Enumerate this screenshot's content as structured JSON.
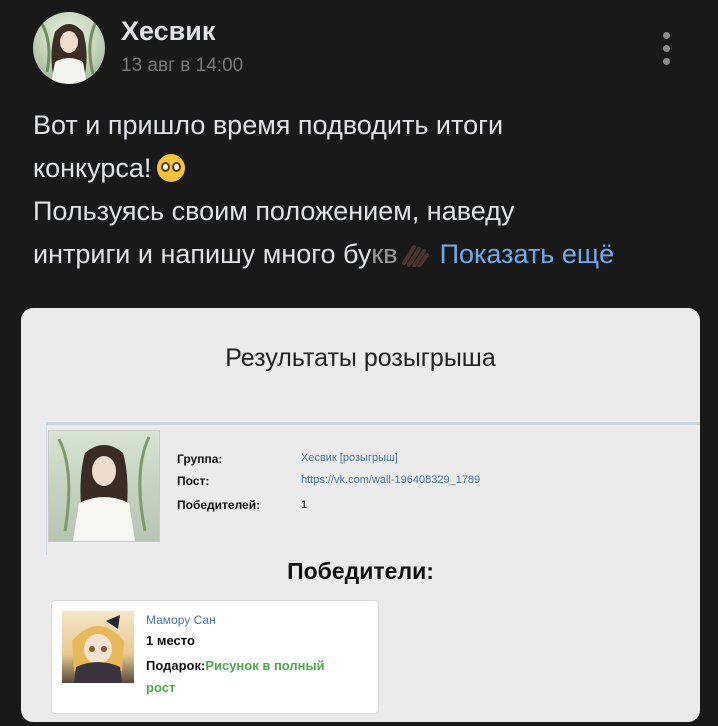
{
  "author": {
    "name": "Хесвик",
    "date": "13 авг в 14:00"
  },
  "post": {
    "line1": "Вот и пришло время подводить итоги",
    "line2": "конкурса!",
    "line3": "Пользуясь своим положением, наведу",
    "line4_main": "интриги и напишу много бу",
    "line4_fade": "кв",
    "show_more": "Показать ещё"
  },
  "card": {
    "title": "Результаты розыгрыша",
    "info": {
      "group_label": "Группа:",
      "group_value": "Хесвик [розыгрыш]",
      "post_label": "Пост:",
      "post_value": "https://vk.com/wall-196408329_1789",
      "winners_count_label": "Победителей:",
      "winners_count_value": "1"
    },
    "winners_title": "Победители:",
    "winners": [
      {
        "name": "Мамору Сан",
        "place": "1 место",
        "gift_label": "Подарок:",
        "gift_value": "Рисунок в полный рост"
      }
    ]
  },
  "icons": {
    "more": "more-vertical-icon",
    "emoji1": "pleading-face-emoji",
    "emoji2": "hand-emoji"
  },
  "colors": {
    "background": "#19191a",
    "text": "#e1e3e6",
    "muted": "#76787a",
    "link": "#71aaeb",
    "card_bg": "#ebebeb",
    "vk_link": "#4a76a8",
    "gift_green": "#4fa84d"
  }
}
